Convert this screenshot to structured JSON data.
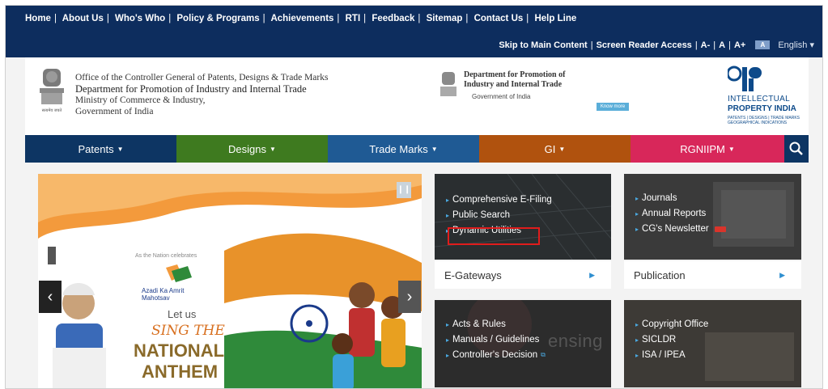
{
  "top_nav": [
    "Home",
    "About Us",
    "Who's Who",
    "Policy & Programs",
    "Achievements",
    "RTI",
    "Feedback",
    "Sitemap",
    "Contact Us",
    "Help Line"
  ],
  "accessibility": {
    "skip": "Skip to Main Content",
    "screen_reader": "Screen Reader Access",
    "font_small": "A-",
    "font_normal": "A",
    "font_large": "A+",
    "contrast": "A",
    "language": "English"
  },
  "org": {
    "line1": "Office of the Controller General of Patents, Designs & Trade Marks",
    "line2": "Department for Promotion of Industry and Internal Trade",
    "line3": "Ministry of Commerce & Industry,",
    "line4": "Government of India"
  },
  "dpiit": {
    "title": "Department for Promotion of Industry and Internal Trade",
    "subtitle": "Government of India",
    "button": "Know more"
  },
  "ipi": {
    "l1": "INTELLECTUAL",
    "l2": "PROPERTY INDIA",
    "l3": "PATENTS | DESIGNS | TRADE MARKS GEOGRAPHICAL INDICATIONS"
  },
  "main_nav": [
    {
      "label": "Patents",
      "color": "#0d3563"
    },
    {
      "label": "Designs",
      "color": "#3e7a1f"
    },
    {
      "label": "Trade Marks",
      "color": "#1f5a94"
    },
    {
      "label": "GI",
      "color": "#b0520e"
    },
    {
      "label": "RGNIIPM",
      "color": "#d8275a"
    }
  ],
  "banner": {
    "line1": "As the Nation celebrates",
    "line2": "Azadi Ka Amrit Mahotsav",
    "line3": "Let us",
    "line4": "SING THE",
    "line5": "NATIONAL",
    "line6": "ANTHEM"
  },
  "egateways": {
    "links": [
      "Comprehensive E-Filing",
      "Public Search",
      "Dynamic Utilities"
    ],
    "title": "E-Gateways"
  },
  "publication": {
    "links": [
      "Journals",
      "Annual Reports",
      "CG's Newsletter"
    ],
    "title": "Publication"
  },
  "acts": {
    "links": [
      "Acts & Rules",
      "Manuals / Guidelines",
      "Controller's Decision"
    ],
    "watermark": "ensing"
  },
  "copyright": {
    "links": [
      "Copyright Office",
      "SICLDR",
      "ISA / IPEA"
    ]
  }
}
